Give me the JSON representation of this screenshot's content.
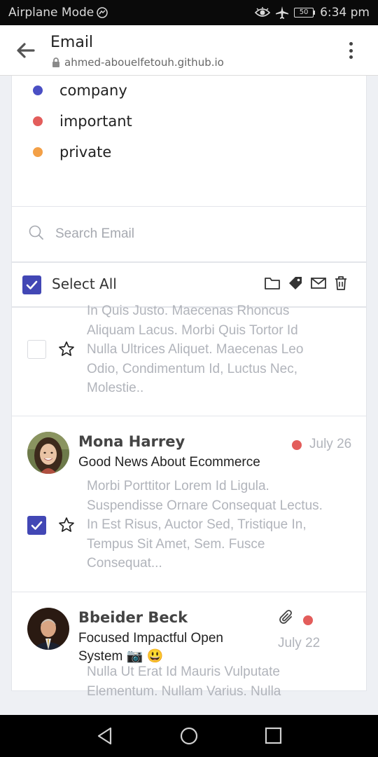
{
  "status_bar": {
    "left_text": "Airplane Mode",
    "battery": "50",
    "time": "6:34 pm"
  },
  "browser": {
    "title": "Email",
    "url": "ahmed-abouelfetouh.github.io"
  },
  "labels": [
    {
      "name": "company",
      "color": "#4a4fc4"
    },
    {
      "name": "important",
      "color": "#e35d5b"
    },
    {
      "name": "private",
      "color": "#f3a047"
    }
  ],
  "search": {
    "placeholder": "Search Email",
    "value": ""
  },
  "toolbar": {
    "select_all_label": "Select All",
    "select_all_checked": true,
    "icons": [
      "folder-icon",
      "tag-icon",
      "mail-icon",
      "trash-icon"
    ]
  },
  "emails": [
    {
      "checked": false,
      "starred": false,
      "preview_lines": [
        "In Quis Justo. Maecenas Rhoncus",
        "Aliquam Lacus. Morbi Quis Tortor Id",
        "Nulla Ultrices Aliquet. Maecenas Leo",
        "Odio, Condimentum Id, Luctus Nec,",
        "Molestie.."
      ]
    },
    {
      "sender": "Mona Harrey",
      "subject": "Good News About Ecommerce",
      "date": "July 26",
      "label_color": "#e35d5b",
      "checked": true,
      "starred": false,
      "preview_lines": [
        "Morbi Porttitor Lorem Id Ligula.",
        "Suspendisse Ornare Consequat Lectus.",
        "In Est Risus, Auctor Sed, Tristique In,",
        "Tempus Sit Amet, Sem. Fusce",
        "Consequat..."
      ]
    },
    {
      "sender": "Bbeider Beck",
      "subject_line1": "Focused Impactful Open",
      "subject_line2": "System 📷 😃",
      "date": "July 22",
      "label_color": "#e35d5b",
      "has_attachment": true,
      "preview_lines": [
        "Nulla Ut Erat Id Mauris Vulputate",
        "Elementum. Nullam Varius. Nulla"
      ]
    }
  ],
  "nav_bar": {
    "buttons": [
      "back-triangle-icon",
      "home-circle-icon",
      "recents-square-icon"
    ]
  }
}
